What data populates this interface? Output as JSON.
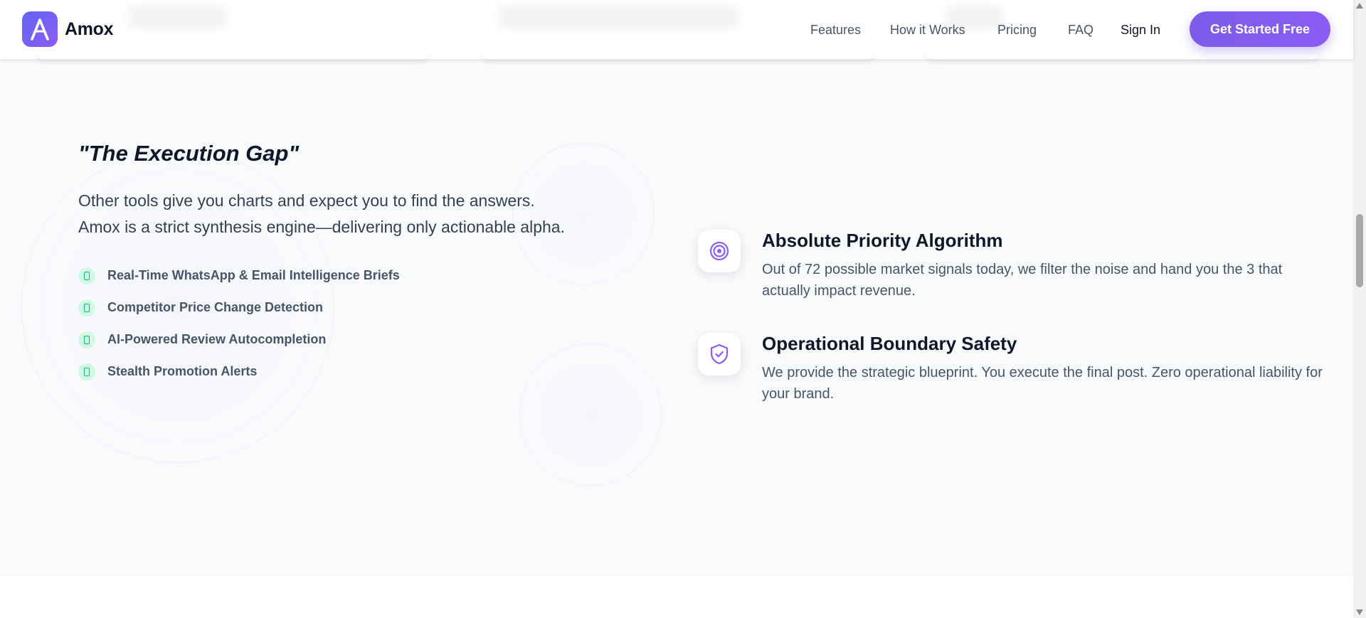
{
  "header": {
    "brand": "Amox",
    "nav": [
      {
        "label": "Features"
      },
      {
        "label": "How it Works"
      },
      {
        "label": "Pricing"
      },
      {
        "label": "FAQ"
      },
      {
        "label": "Sign In"
      }
    ],
    "cta_label": "Get Started Free"
  },
  "section": {
    "heading": "\"The Execution Gap\"",
    "lead_line1": "Other tools give you charts and expect you to find the answers.",
    "lead_line2": "Amox is a strict synthesis engine—delivering only actionable alpha.",
    "features": [
      "Real-Time WhatsApp & Email Intelligence Briefs",
      "Competitor Price Change Detection",
      "AI-Powered Review Autocompletion",
      "Stealth Promotion Alerts"
    ],
    "cards": [
      {
        "icon": "target-icon",
        "title": "Absolute Priority Algorithm",
        "description": "Out of 72 possible market signals today, we filter the noise and hand you the 3 that actually impact revenue."
      },
      {
        "icon": "shield-check-icon",
        "title": "Operational Boundary Safety",
        "description": "We provide the strategic blueprint. You execute the final post. Zero operational liability for your brand."
      }
    ]
  },
  "colors": {
    "brand_start": "#6366f1",
    "brand_end": "#8b5cf6",
    "accent_green": "#10b981",
    "section_bg": "#f8fafc",
    "text_dark": "#0f172a"
  }
}
